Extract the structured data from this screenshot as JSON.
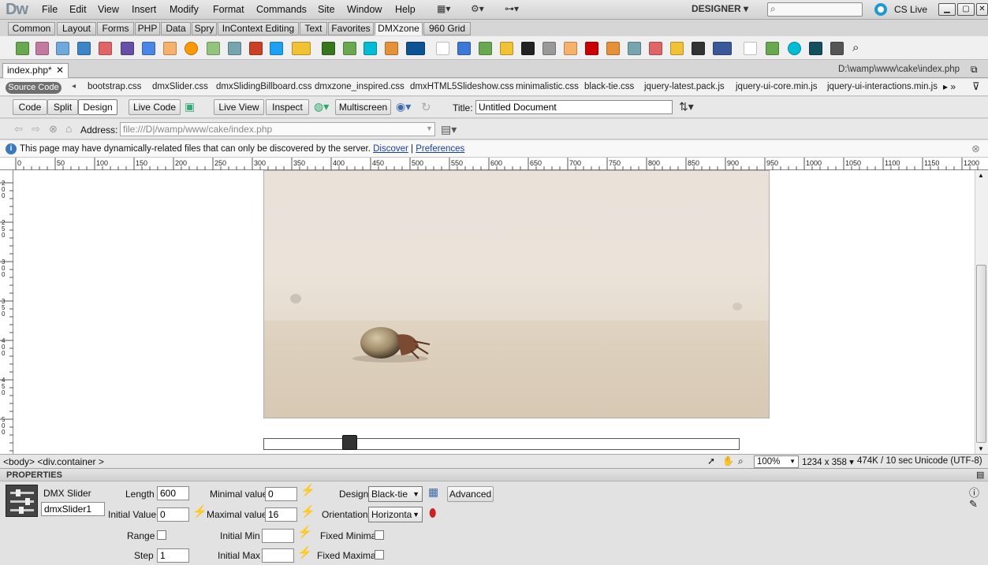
{
  "app": {
    "logo": "Dw",
    "workspace": "DESIGNER",
    "cs_live": "CS Live"
  },
  "menu": [
    "File",
    "Edit",
    "View",
    "Insert",
    "Modify",
    "Format",
    "Commands",
    "Site",
    "Window",
    "Help"
  ],
  "insert_tabs": [
    "Common",
    "Layout",
    "Forms",
    "PHP",
    "Data",
    "Spry",
    "InContext Editing",
    "Text",
    "Favorites",
    "DMXzone",
    "960 Grid"
  ],
  "active_insert_tab": "DMXzone",
  "document": {
    "tab_label": "index.php*",
    "path": "D:\\wamp\\www\\cake\\index.php"
  },
  "related_files": {
    "source_code": "Source Code",
    "files": [
      "bootstrap.css",
      "dmxSlider.css",
      "dmxSlidingBillboard.css",
      "dmxzone_inspired.css",
      "dmxHTML5Slideshow.css",
      "minimalistic.css",
      "black-tie.css",
      "jquery-latest.pack.js",
      "jquery-ui-core.min.js",
      "jquery-ui-interactions.min.js"
    ]
  },
  "doc_toolbar": {
    "code": "Code",
    "split": "Split",
    "design": "Design",
    "live_code": "Live Code",
    "live_view": "Live View",
    "inspect": "Inspect",
    "multiscreen": "Multiscreen",
    "title_label": "Title:",
    "title_value": "Untitled Document"
  },
  "address": {
    "label": "Address:",
    "value": "file:///D|/wamp/www/cake/index.php"
  },
  "infobar": {
    "message": "This page may have dynamically-related files that can only be discovered by the server.",
    "discover": "Discover",
    "separator": "|",
    "preferences": "Preferences"
  },
  "ruler_h": [
    "0",
    "50",
    "100",
    "150",
    "200",
    "250",
    "300",
    "350",
    "400",
    "450",
    "500",
    "550",
    "600",
    "650",
    "700",
    "750",
    "800",
    "850",
    "900",
    "950",
    "1000",
    "1050",
    "1100",
    "1150",
    "1200"
  ],
  "ruler_v": [
    "200",
    "250",
    "300",
    "350",
    "400",
    "450",
    "500"
  ],
  "slider": {
    "length": 600,
    "value": 16,
    "max": 100
  },
  "status": {
    "tag_path": "<body> <div.container >",
    "zoom": "100%",
    "dimensions": "1234 x 358",
    "size": "474K / 10 sec",
    "encoding": "Unicode (UTF-8)"
  },
  "properties": {
    "header": "PROPERTIES",
    "widget_name": "DMX Slider",
    "widget_id": "dmxSlider1",
    "length_label": "Length",
    "length_value": "600",
    "initial_value_label": "Initial Value",
    "initial_value": "0",
    "min_label": "Minimal value",
    "min_value": "0",
    "max_label": "Maximal value",
    "max_value": "16",
    "design_label": "Design",
    "design_value": "Black-tie",
    "orientation_label": "Orientation",
    "orientation_value": "Horizonta",
    "advanced": "Advanced",
    "range_label": "Range",
    "step_label": "Step",
    "step_value": "1",
    "initial_min_label": "Initial Min",
    "initial_max_label": "Initial Max",
    "fixed_min_label": "Fixed Minimal",
    "fixed_max_label": "Fixed Maximal"
  }
}
